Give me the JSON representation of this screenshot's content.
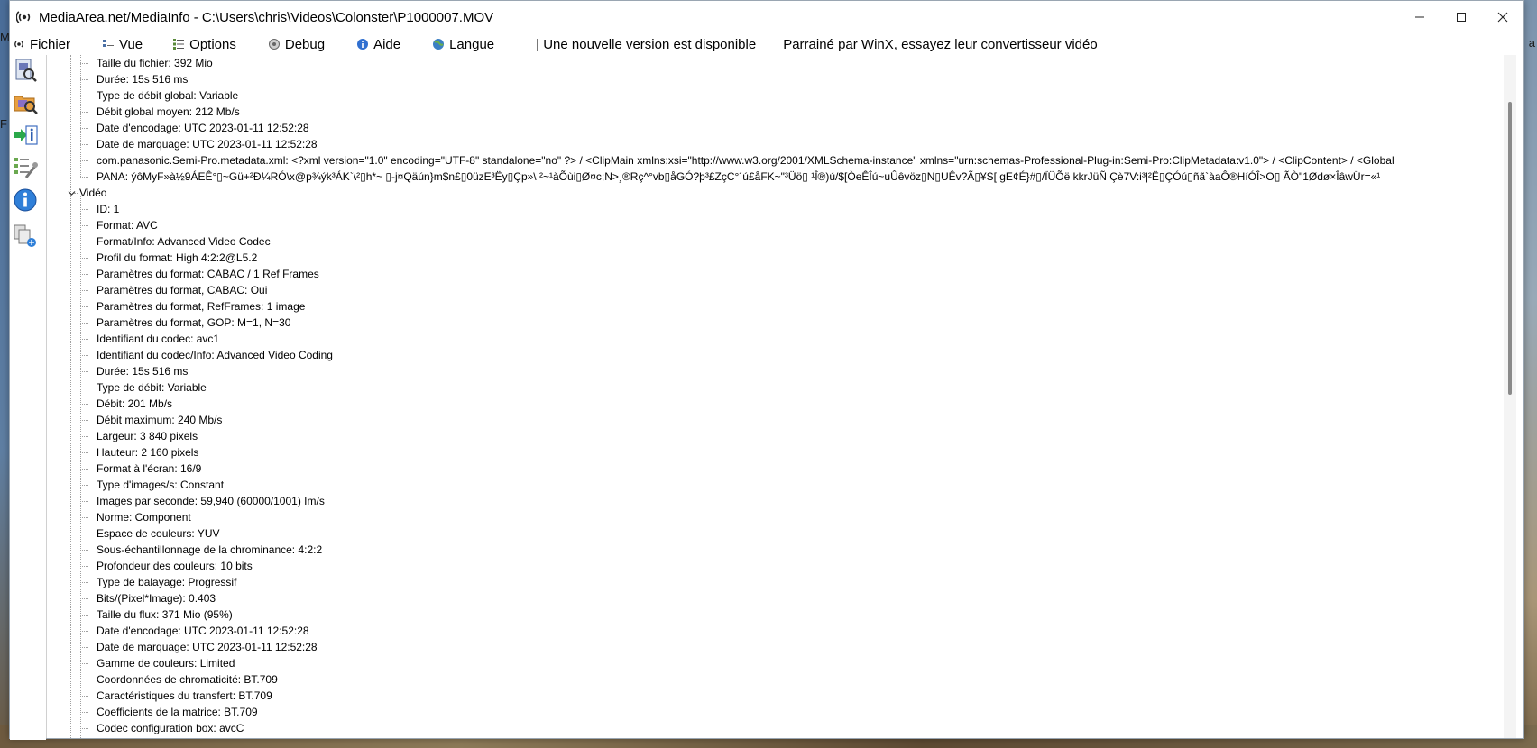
{
  "window": {
    "title": "MediaArea.net/MediaInfo - C:\\Users\\chris\\Videos\\Colonster\\P1000007.MOV",
    "minimize": "—",
    "maximize": "☐",
    "close": "✕"
  },
  "desktop": {
    "left_glyph": "M",
    "right_glyph": "a",
    "left_glyph2": "F"
  },
  "menu": {
    "items": [
      {
        "label": "Fichier",
        "icon": "file-icon"
      },
      {
        "label": "Vue",
        "icon": "view-icon"
      },
      {
        "label": "Options",
        "icon": "options-icon"
      },
      {
        "label": "Debug",
        "icon": "debug-icon"
      },
      {
        "label": "Aide",
        "icon": "help-icon"
      },
      {
        "label": "Langue",
        "icon": "language-icon"
      }
    ],
    "update_notice": "| Une nouvelle version est disponible",
    "sponsor": "Parrainé par WinX, essayez leur convertisseur vidéo"
  },
  "toolbar": {
    "icons": [
      "open-file-icon",
      "open-folder-icon",
      "export-icon",
      "preferences-icon",
      "about-icon",
      "windows-context-icon"
    ]
  },
  "tree": {
    "general_rows": [
      "Taille du fichier: 392 Mio",
      "Durée: 15s 516 ms",
      "Type de débit global: Variable",
      "Débit global moyen: 212 Mb/s",
      "Date d'encodage: UTC 2023-01-11 12:52:28",
      "Date de marquage: UTC 2023-01-11 12:52:28",
      "com.panasonic.Semi-Pro.metadata.xml: <?xml version=\"1.0\" encoding=\"UTF-8\" standalone=\"no\" ?> / <ClipMain xmlns:xsi=\"http://www.w3.org/2001/XMLSchema-instance\" xmlns=\"urn:schemas-Professional-Plug-in:Semi-Pro:ClipMetadata:v1.0\"> /   <ClipContent> /     <Global",
      "PANA: ýôMyF»à½9ÁEÊ°▯~Gü+²Ð¼RÓ\\x@p¾ýk³ÁK`\\²▯h*~ ▯-j¤Qäún}m$n£▯0üzE³Ëy▯Çp»\\ ²~¹àÕùi▯Ø¤c;N>¸®Rç^°vb▯åGÓ?þ³£ZçC°´ú£åFK~\"³Üö▯ ¹Î®)ú/$[ÒeÊÎú~uÛêvöz▯N▯UÊv?Ã▯¥S[ gE¢É}#▯/ÏÜÕë  kkrJüÑ  Çè7V:i³|²Ë▯ÇÓú▯ñã`àaÔ®HíÓÎ>O▯ ÃÒ\"1Ødø×ÎâwÜr=«¹"
    ],
    "video_section": "Vidéo",
    "video_rows": [
      "ID: 1",
      "Format: AVC",
      "Format/Info: Advanced Video Codec",
      "Profil du format: High 4:2:2@L5.2",
      "Paramètres du format: CABAC / 1 Ref Frames",
      "Paramètres du format, CABAC: Oui",
      "Paramètres du format, RefFrames: 1 image",
      "Paramètres du format, GOP: M=1, N=30",
      "Identifiant du codec: avc1",
      "Identifiant du codec/Info: Advanced Video Coding",
      "Durée: 15s 516 ms",
      "Type de débit: Variable",
      "Débit: 201 Mb/s",
      "Débit maximum: 240 Mb/s",
      "Largeur: 3 840 pixels",
      "Hauteur: 2 160 pixels",
      "Format à l'écran: 16/9",
      "Type d'images/s: Constant",
      "Images par seconde: 59,940 (60000/1001) Im/s",
      "Norme: Component",
      "Espace de couleurs: YUV",
      "Sous-échantillonnage de la chrominance: 4:2:2",
      "Profondeur des couleurs: 10 bits",
      "Type de balayage: Progressif",
      "Bits/(Pixel*Image): 0.403",
      "Taille du flux: 371 Mio (95%)",
      "Date d'encodage: UTC 2023-01-11 12:52:28",
      "Date de marquage: UTC 2023-01-11 12:52:28",
      "Gamme de couleurs: Limited",
      "Coordonnées de chromaticité: BT.709",
      "Caractéristiques du transfert: BT.709",
      "Coefficients de la matrice: BT.709",
      "Codec configuration box: avcC"
    ]
  },
  "colors": {
    "window_bg": "#ffffff",
    "tree_line": "#a0a0a0",
    "scroll_thumb": "#8a8a8a"
  }
}
